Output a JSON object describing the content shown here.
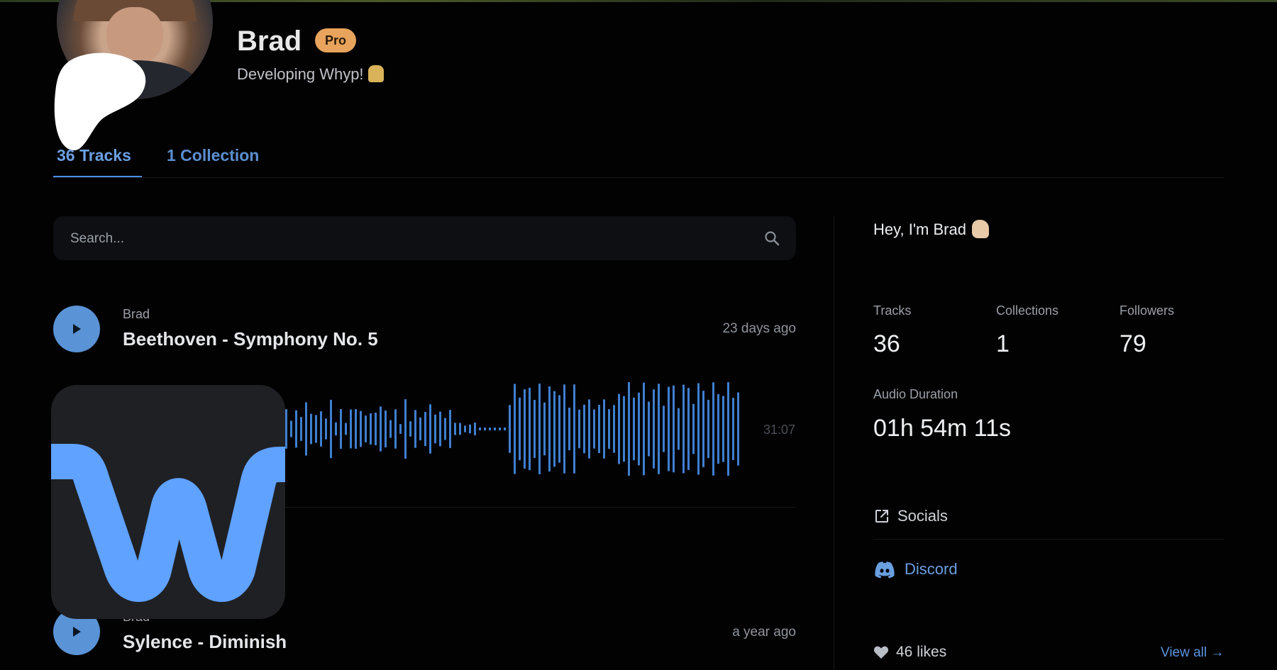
{
  "profile": {
    "name": "Brad",
    "badge": "Pro",
    "bio": "Developing Whyp!"
  },
  "tabs": [
    {
      "label": "36 Tracks",
      "active": true
    },
    {
      "label": "1 Collection",
      "active": false
    }
  ],
  "search": {
    "placeholder": "Search..."
  },
  "tracks": [
    {
      "artist": "Brad",
      "title": "Beethoven - Symphony No. 5",
      "date": "23 days ago",
      "duration": "31:07"
    },
    {
      "artist": "Brad",
      "title": "Sylence - Diminish",
      "date": "a year ago"
    }
  ],
  "sidebar": {
    "greeting": "Hey, I'm Brad",
    "stats": [
      {
        "label": "Tracks",
        "value": "36"
      },
      {
        "label": "Collections",
        "value": "1"
      },
      {
        "label": "Followers",
        "value": "79"
      }
    ],
    "audio_duration": {
      "label": "Audio Duration",
      "value": "01h 54m 11s"
    },
    "socials_label": "Socials",
    "discord_label": "Discord",
    "likes_label": "46 likes",
    "view_all_label": "View all →"
  },
  "colors": {
    "accent": "#5a93d6",
    "pro_badge": "#e8a45c",
    "background": "#020202"
  },
  "icons": [
    "search-icon",
    "play-icon",
    "external-link-icon",
    "discord-icon",
    "heart-icon",
    "whyp-logo-icon"
  ]
}
